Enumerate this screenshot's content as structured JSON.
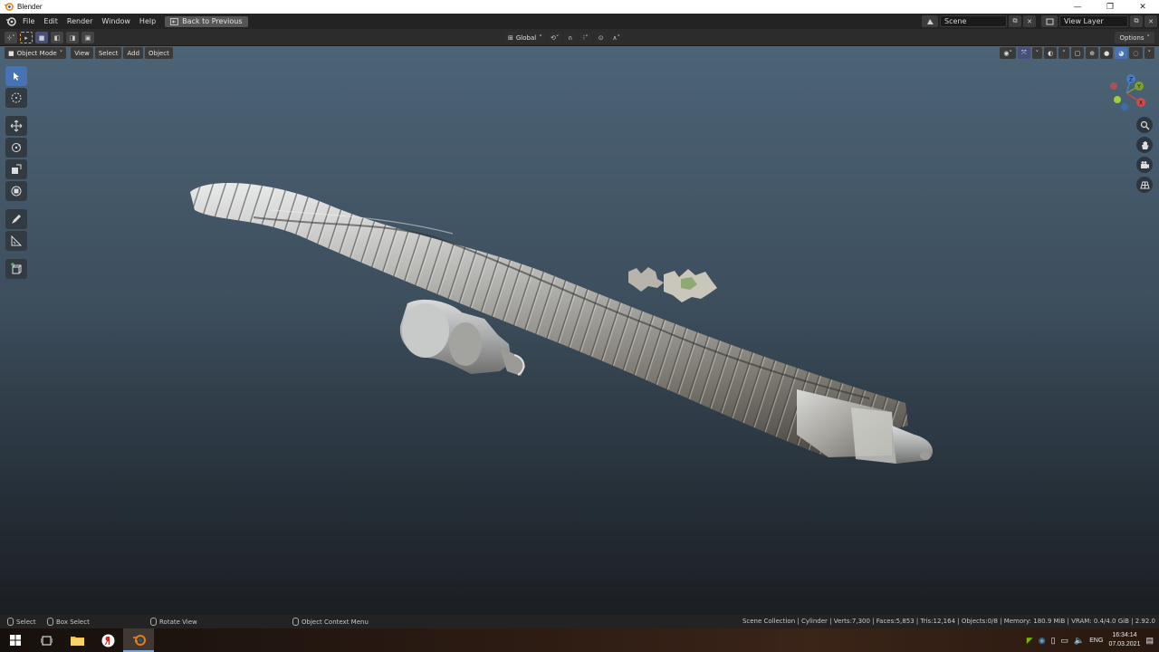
{
  "window": {
    "title": "Blender",
    "minimize": "—",
    "restore": "❐",
    "close": "✕"
  },
  "menu": {
    "items": [
      "File",
      "Edit",
      "Render",
      "Window",
      "Help"
    ],
    "back_button": "Back to Previous",
    "scene": "Scene",
    "view_layer": "View Layer"
  },
  "tool_header": {
    "transform_orientation": "Global",
    "options": "Options"
  },
  "viewport_header": {
    "mode": "Object Mode",
    "menus": [
      "View",
      "Select",
      "Add",
      "Object"
    ]
  },
  "axes": {
    "x": "X",
    "y": "Y",
    "z": "Z"
  },
  "status": {
    "select": "Select",
    "box_select": "Box Select",
    "rotate_view": "Rotate View",
    "context_menu": "Object Context Menu",
    "stats": "Scene Collection | Cylinder | Verts:7,300 | Faces:5,853 | Tris:12,164 | Objects:0/8 | Memory: 180.9 MiB | VRAM: 0.4/4.0 GiB | 2.92.0"
  },
  "taskbar": {
    "language": "ENG",
    "time": "16:34:14",
    "date": "07.03.2021"
  }
}
